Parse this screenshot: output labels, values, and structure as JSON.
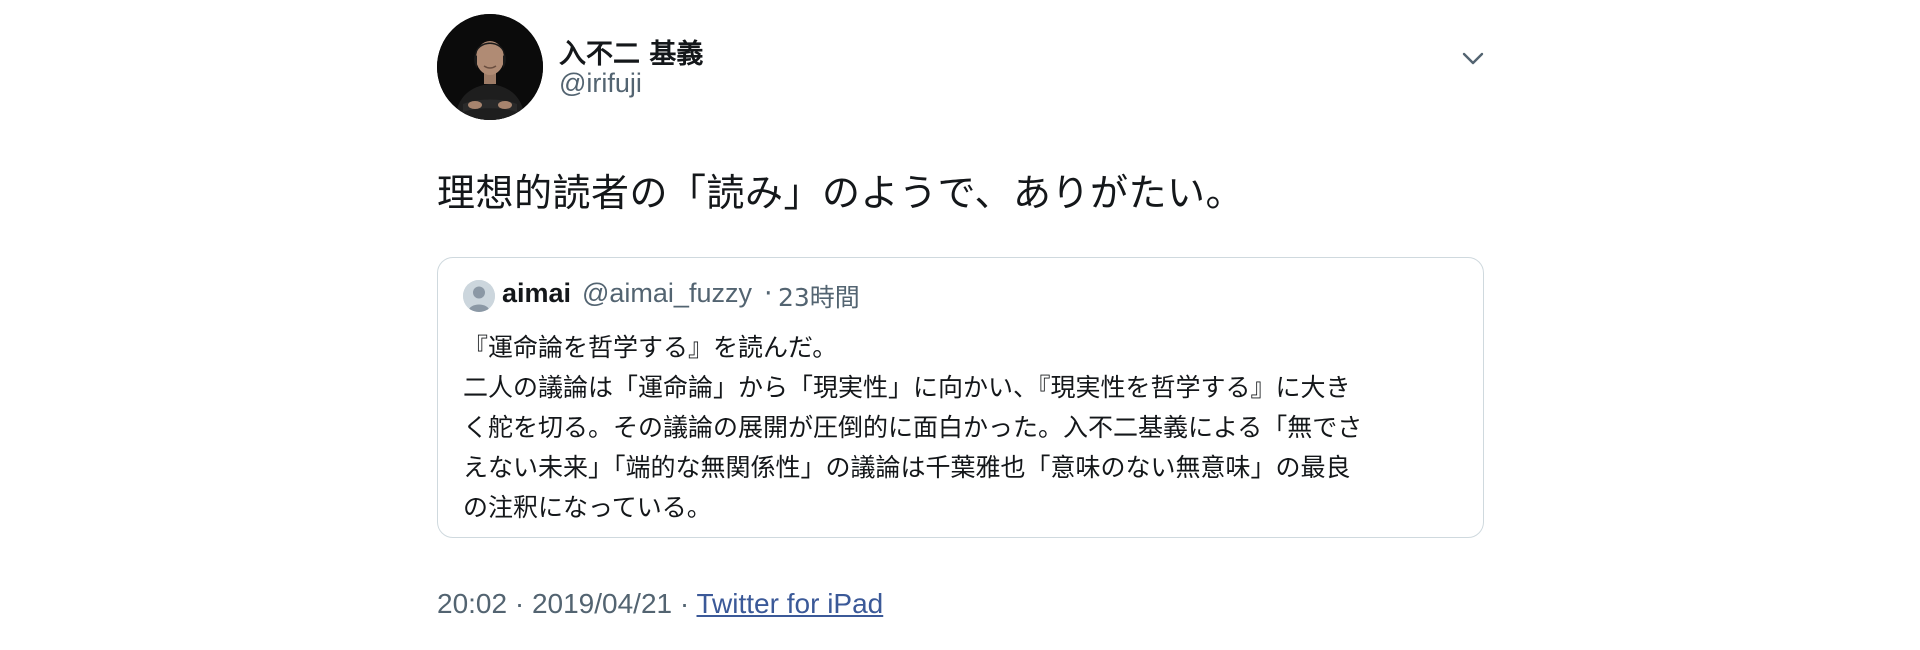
{
  "author": {
    "display_name": "入不二 基義",
    "handle": "@irifuji"
  },
  "tweet": {
    "text": "理想的読者の「読み」のようで、ありがたい。"
  },
  "quoted_tweet": {
    "display_name": "aimai",
    "handle": "@aimai_fuzzy",
    "separator": "·",
    "time": "23時間",
    "lines": [
      "『運命論を哲学する』を読んだ。",
      "二人の議論は「運命論」から「現実性」に向かい、『現実性を哲学する』に大き",
      "く舵を切る。その議論の展開が圧倒的に面白かった。入不二基義による「無でさ",
      "えない未来」「端的な無関係性」の議論は千葉雅也「意味のない無意味」の最良",
      "の注釈になっている。"
    ]
  },
  "footer": {
    "time": "20:02",
    "sep1": " · ",
    "date": "2019/04/21",
    "sep2": " · ",
    "source": "Twitter for iPad"
  },
  "icons": {
    "menu": "chevron-down-icon",
    "default_avatar": "default-avatar-icon"
  },
  "colors": {
    "text": "#14171a",
    "secondary": "#536471",
    "border": "#cfd9de",
    "link": "#3b5998"
  }
}
